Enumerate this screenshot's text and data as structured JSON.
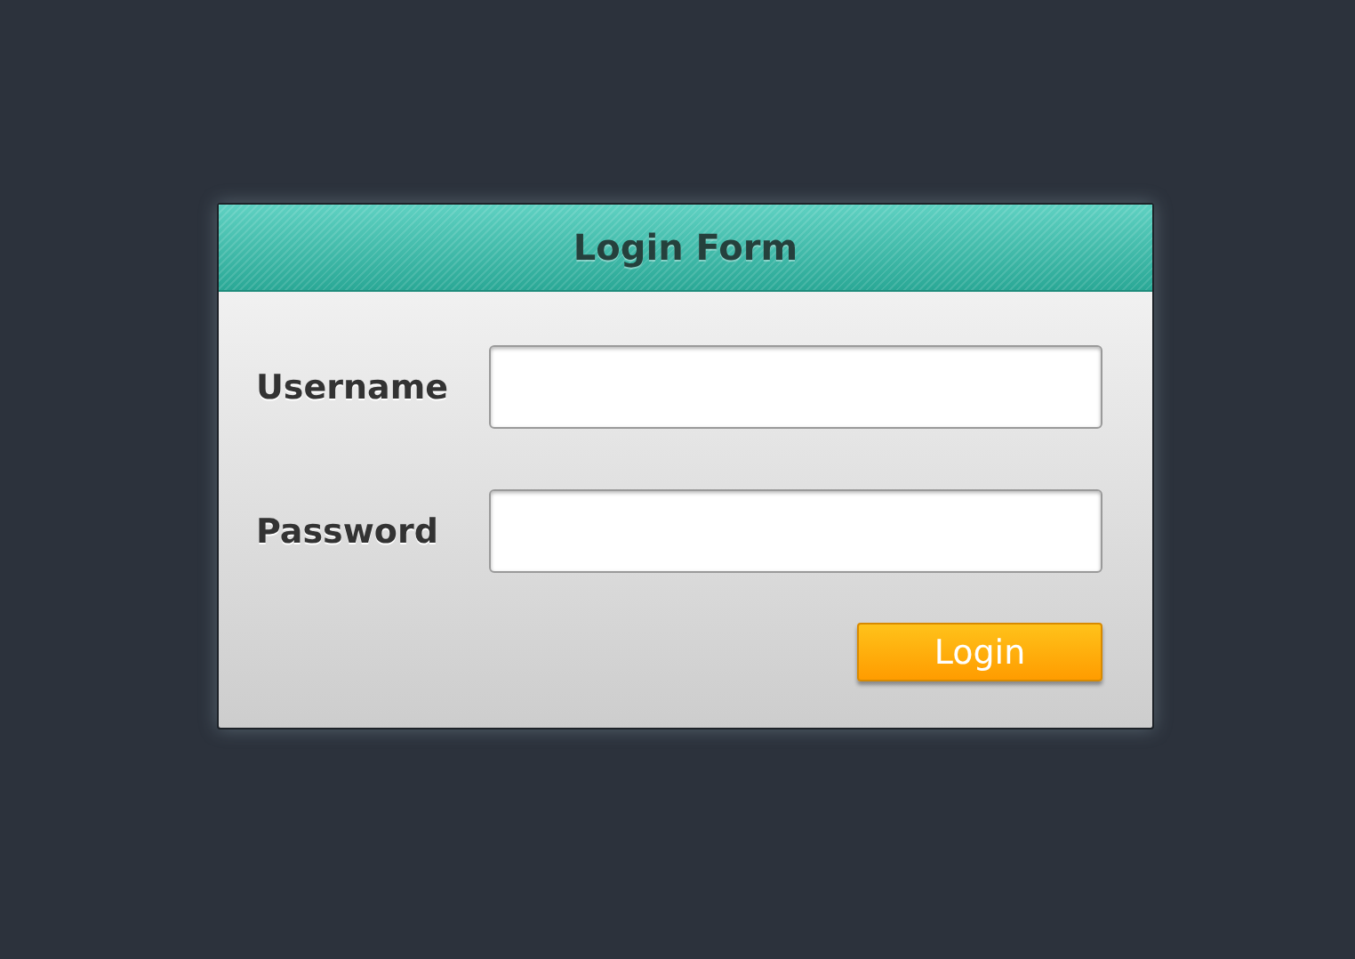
{
  "form": {
    "title": "Login Form",
    "fields": [
      {
        "label": "Username"
      },
      {
        "label": "Password"
      }
    ],
    "button": "Login"
  }
}
